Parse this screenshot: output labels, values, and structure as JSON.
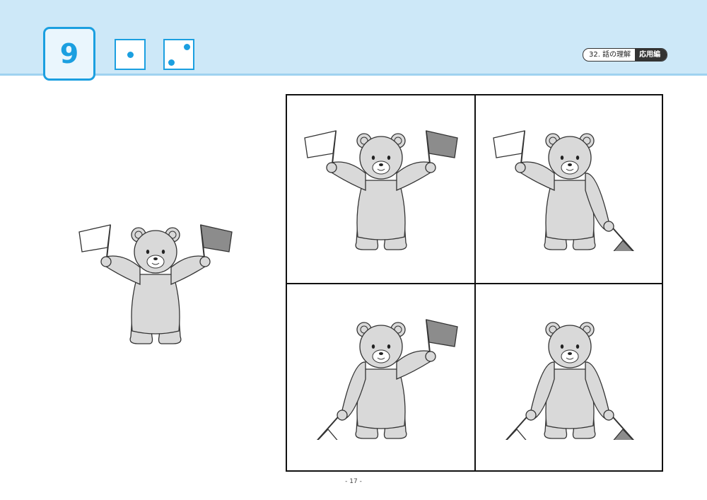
{
  "header": {
    "problem_number": "9",
    "dice": [
      {
        "name": "dice-one",
        "pips": 1
      },
      {
        "name": "dice-two",
        "pips": 2
      }
    ],
    "badge": {
      "topic": "32. 話の理解",
      "level": "応用編"
    }
  },
  "colors": {
    "accent": "#1b9fe0",
    "header_bg": "#cde8f8",
    "bear_fill": "#d9d9d9",
    "flag_white": "#ffffff",
    "flag_gray": "#8c8c8c"
  },
  "prompt_picture": {
    "subject": "bear-with-flags",
    "left_arm": "up",
    "left_flag": "white",
    "right_arm": "up",
    "right_flag": "gray"
  },
  "choices": [
    {
      "id": "choice-1",
      "left_arm": "up",
      "left_flag": "white",
      "right_arm": "up",
      "right_flag": "gray"
    },
    {
      "id": "choice-2",
      "left_arm": "up",
      "left_flag": "white",
      "right_arm": "down",
      "right_flag": "gray"
    },
    {
      "id": "choice-3",
      "left_arm": "down",
      "left_flag": "white",
      "right_arm": "up",
      "right_flag": "gray"
    },
    {
      "id": "choice-4",
      "left_arm": "down",
      "left_flag": "white",
      "right_arm": "down",
      "right_flag": "gray"
    }
  ],
  "footer": {
    "page_number": "- 17 -"
  }
}
